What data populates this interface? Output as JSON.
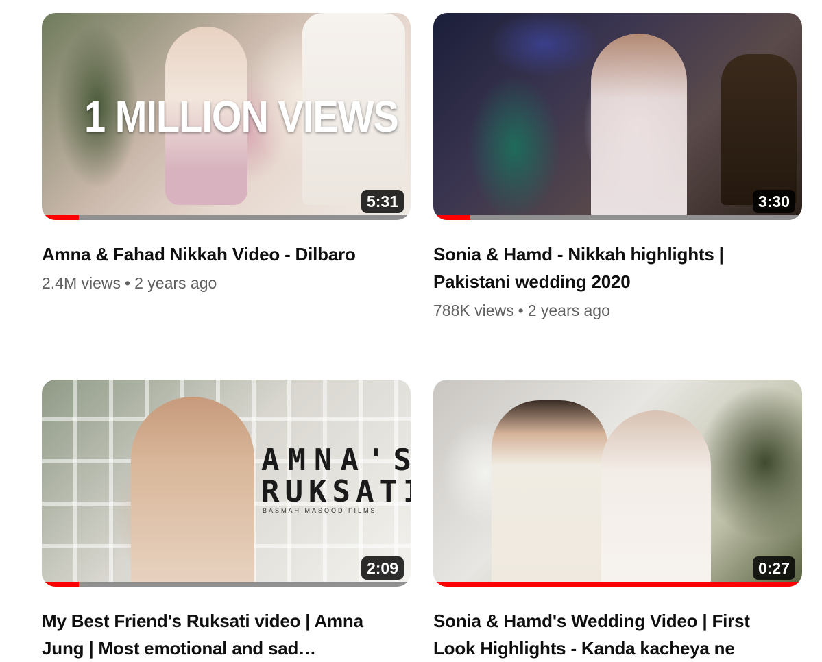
{
  "videos": [
    {
      "title_lines": [
        "Amna & Fahad Nikkah Video - Dilbaro"
      ],
      "views": "2.4M views",
      "age": "2 years ago",
      "duration": "5:31",
      "watched_fraction": 0.1,
      "thumbnail_text": "1 MILLION VIEWS"
    },
    {
      "title_lines": [
        "Sonia & Hamd - Nikkah highlights |",
        "Pakistani wedding 2020"
      ],
      "views": "788K views",
      "age": "2 years ago",
      "duration": "3:30",
      "watched_fraction": 0.1
    },
    {
      "title_lines": [
        "My Best Friend's Ruksati video | Amna",
        "Jung | Most emotional and sad…"
      ],
      "duration": "2:09",
      "watched_fraction": 0.1,
      "thumbnail_text_line1": "AMNA'S",
      "thumbnail_text_line2": "RUKSATI",
      "thumbnail_credit": "BASMAH MASOOD FILMS"
    },
    {
      "title_lines": [
        "Sonia & Hamd's Wedding Video | First",
        "Look Highlights - Kanda kacheya ne"
      ],
      "duration": "0:27",
      "watched_fraction": 1.0
    }
  ],
  "colors": {
    "progress_red": "#ff0000",
    "progress_track": "#909090",
    "meta_gray": "#606060"
  }
}
